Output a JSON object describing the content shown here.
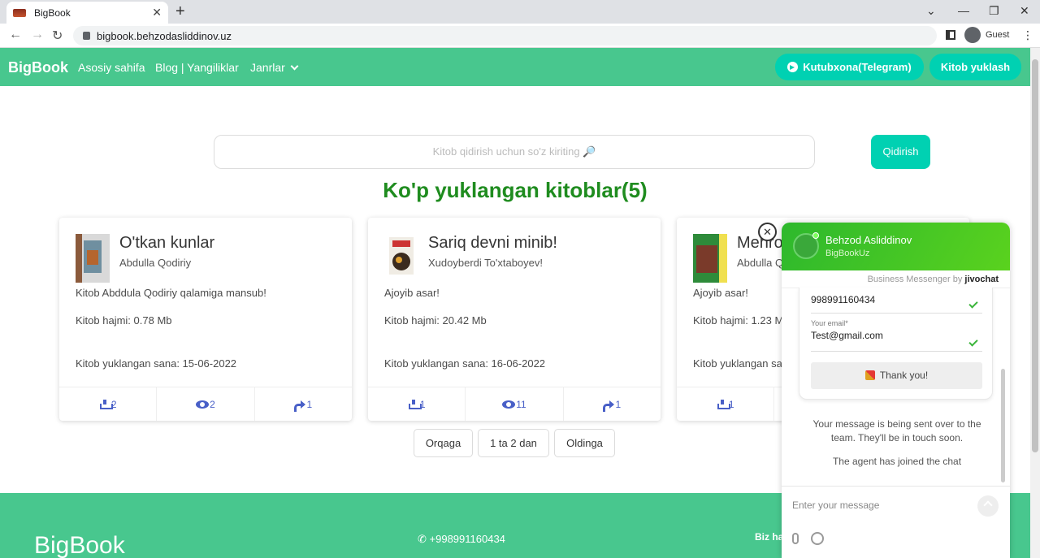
{
  "browser": {
    "tab_title": "BigBook",
    "tab_close": "✕",
    "new_tab": "+",
    "url": "bigbook.behzodasliddinov.uz",
    "profile": "Guest",
    "back": "←",
    "forward": "→",
    "reload": "↻",
    "minimize": "⌄",
    "min2": "—",
    "restore": "❐",
    "close": "✕",
    "menu": "⋮"
  },
  "nav": {
    "brand": "BigBook",
    "links": [
      "Asosiy sahifa",
      "Blog | Yangiliklar",
      "Janrlar"
    ],
    "telegram_button": "Kutubxona(Telegram)",
    "upload_button": "Kitob yuklash"
  },
  "search": {
    "placeholder": "Kitob qidirish uchun so'z kiriting 🔎",
    "button": "Qidirish"
  },
  "heading": "Ko'p yuklangan kitoblar(5)",
  "books": [
    {
      "title": "O'tkan kunlar",
      "author": "Abdulla Qodiriy",
      "description": "Kitob Abddula Qodiriy qalamiga mansub!",
      "size": "Kitob hajmi: 0.78 Mb",
      "date": "Kitob yuklangan sana: 15-06-2022",
      "downloads": "2",
      "views": "2",
      "shares": "1"
    },
    {
      "title": "Sariq devni minib!",
      "author": "Xudoyberdi To'xtaboyev!",
      "description": "Ajoyib asar!",
      "size": "Kitob hajmi: 20.42 Mb",
      "date": "Kitob yuklangan sana: 16-06-2022",
      "downloads": "1",
      "views": "11",
      "shares": "1"
    },
    {
      "title": "Mehro",
      "author": "Abdulla Q",
      "description": "Ajoyib asar!",
      "size": "Kitob hajmi: 1.23 M",
      "date": "Kitob yuklangan sana",
      "downloads": "1",
      "views": "",
      "shares": ""
    }
  ],
  "pagination": {
    "prev": "Orqaga",
    "page_info": "1 ta 2 dan",
    "next": "Oldinga"
  },
  "footer": {
    "brand": "BigBook",
    "phone": "+998991160434",
    "about": "Biz ha"
  },
  "chat": {
    "close": "✕",
    "agent_name": "Behzod Asliddinov",
    "agent_sub": "BigBookUz",
    "powered_prefix": "Business Messenger by ",
    "powered_brand": "jivochat",
    "phone_value": "998991160434",
    "email_label": "Your email*",
    "email_value": "Test@gmail.com",
    "thanks": "Thank you!",
    "message_sent": "Your message is being sent over to the team. They'll be in touch soon.",
    "agent_joined": "The agent has joined the chat",
    "input_placeholder": "Enter your message"
  },
  "colors": {
    "brand_green": "#48c78e",
    "accent_teal": "#00d1b2",
    "heading_green": "#1f8c1f",
    "link_blue": "#485fc7"
  }
}
